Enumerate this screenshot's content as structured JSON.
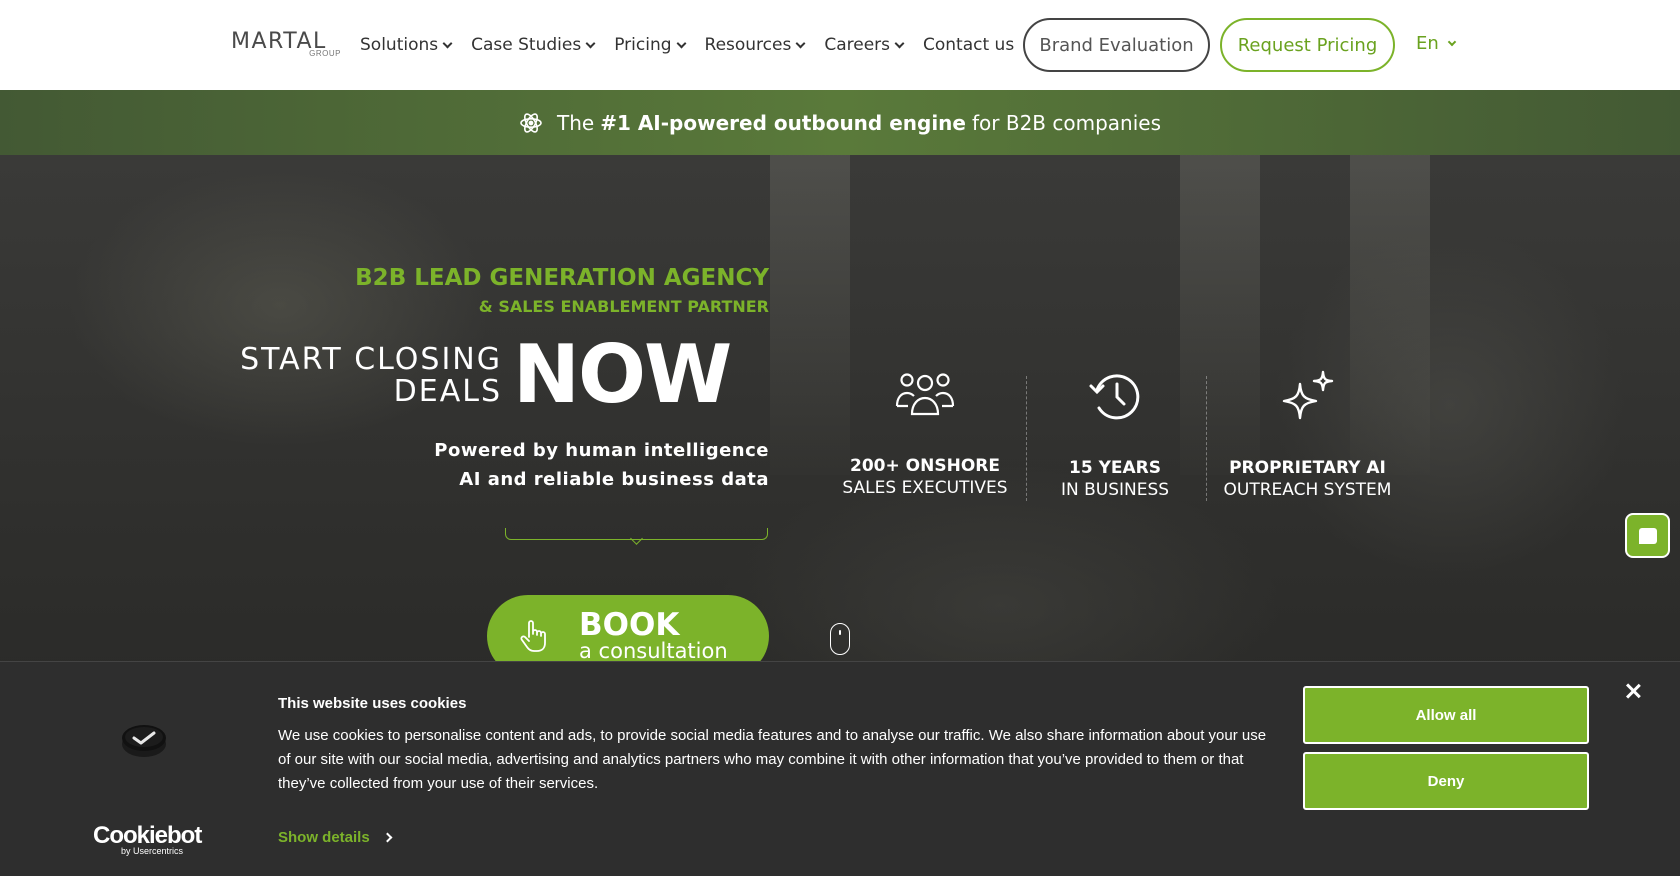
{
  "nav": {
    "logo_text": "MARTAL",
    "logo_sub": "GROUP",
    "menu": [
      {
        "label": "Solutions"
      },
      {
        "label": "Case Studies"
      },
      {
        "label": "Pricing"
      },
      {
        "label": "Resources"
      },
      {
        "label": "Careers"
      },
      {
        "label": "Contact us"
      }
    ],
    "brand_button": "Brand Evaluation",
    "pricing_button": "Request Pricing",
    "language": "En"
  },
  "banner": {
    "prefix": "The",
    "bold": "#1 AI-powered outbound engine",
    "suffix": "for B2B companies"
  },
  "hero": {
    "tagline_1": "B2B LEAD GENERATION AGENCY",
    "tagline_2": "& SALES ENABLEMENT PARTNER",
    "start_line_1": "START CLOSING",
    "start_line_2": "DEALS",
    "now": "NOW",
    "powered_line_1": "Powered by human intelligence",
    "powered_line_2": "AI and reliable business data",
    "book_main": "BOOK",
    "book_sub": "a consultation",
    "stats": [
      {
        "icon": "team-icon",
        "line1": "200+ ONSHORE",
        "line2": "SALES EXECUTIVES"
      },
      {
        "icon": "history-clock-icon",
        "line1": "15 YEARS",
        "line2": "IN BUSINESS"
      },
      {
        "icon": "sparkle-icon",
        "line1": "PROPRIETARY AI",
        "line2": "OUTREACH SYSTEM"
      }
    ]
  },
  "cookie": {
    "title": "This website uses cookies",
    "text": "We use cookies to personalise content and ads, to provide social media features and to analyse our traffic. We also share information about your use of our site with our social media, advertising and analytics partners who may combine it with other information that you’ve provided to them or that they’ve collected from your use of their services.",
    "show_details": "Show details",
    "allow_all": "Allow all",
    "deny": "Deny",
    "brand": "Cookiebot",
    "brand_by": "by Usercentrics"
  },
  "colors": {
    "accent": "#7cb32a",
    "banner": "#4e6b37",
    "cookie_bg": "#2e2e2e"
  }
}
